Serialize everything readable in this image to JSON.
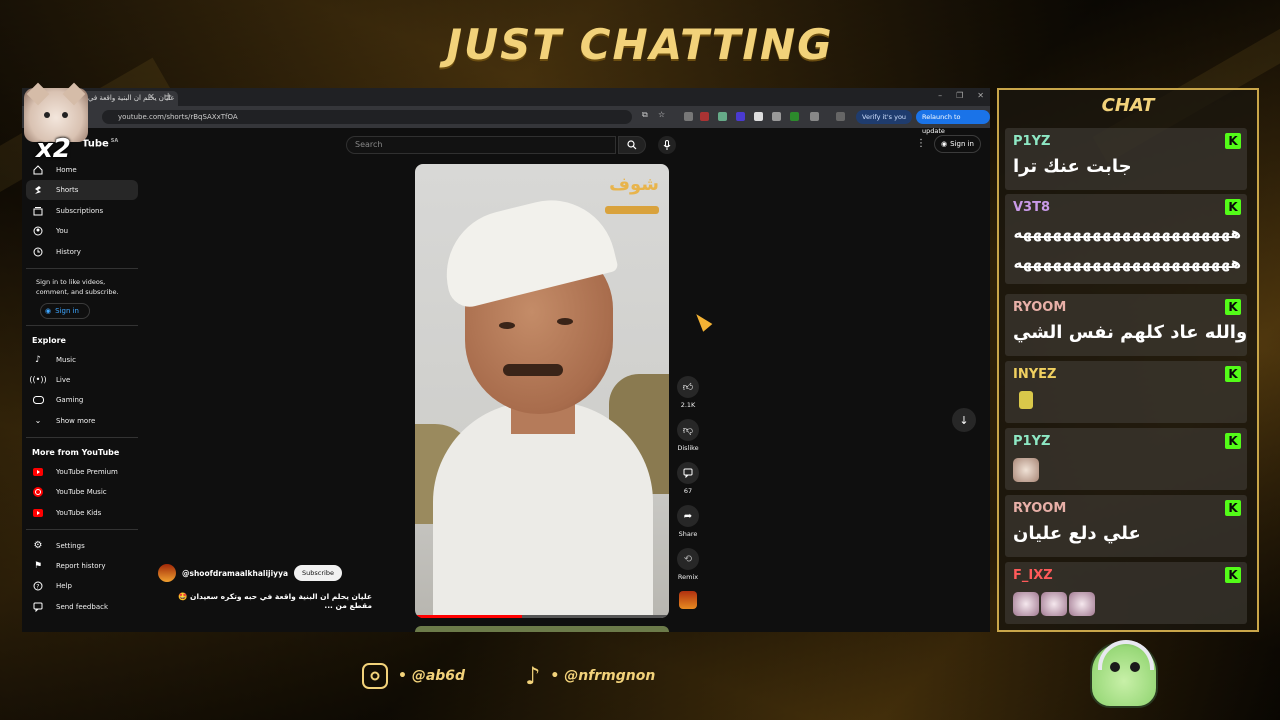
{
  "overlay": {
    "title": "JUST CHATTING",
    "cat_multiplier": "x2",
    "instagram": "@ab6d",
    "tiktok": "@nfrmgnon"
  },
  "browser": {
    "tab_title": "عليان يحلم ان البنية واقعة في",
    "url": "youtube.com/shorts/rBqSAXxTfOA",
    "verify_label": "Verify it's you",
    "relaunch_label": "Relaunch to update"
  },
  "youtube": {
    "logo_text": "Tube",
    "logo_region": "SA",
    "search_placeholder": "Search",
    "signin_top": "Sign in",
    "nav": [
      {
        "label": "Home",
        "icon": "home-icon"
      },
      {
        "label": "Shorts",
        "icon": "shorts-icon"
      },
      {
        "label": "Subscriptions",
        "icon": "subscriptions-icon"
      },
      {
        "label": "You",
        "icon": "user-icon"
      },
      {
        "label": "History",
        "icon": "history-icon"
      }
    ],
    "signin_note": "Sign in to like videos, comment, and subscribe.",
    "signin_side": "Sign in",
    "explore_heading": "Explore",
    "explore": [
      {
        "label": "Music",
        "icon": "music-icon"
      },
      {
        "label": "Live",
        "icon": "live-icon"
      },
      {
        "label": "Gaming",
        "icon": "gaming-icon"
      },
      {
        "label": "Show more",
        "icon": "chevron-down-icon"
      }
    ],
    "more_heading": "More from YouTube",
    "more": [
      {
        "label": "YouTube Premium"
      },
      {
        "label": "YouTube Music"
      },
      {
        "label": "YouTube Kids"
      }
    ],
    "footer_nav": [
      {
        "label": "Settings",
        "icon": "gear-icon"
      },
      {
        "label": "Report history",
        "icon": "flag-icon"
      },
      {
        "label": "Help",
        "icon": "help-icon"
      },
      {
        "label": "Send feedback",
        "icon": "feedback-icon"
      }
    ],
    "video": {
      "watermark": "شوف",
      "progress": 0.42,
      "likes": "2.1K",
      "dislike_label": "Dislike",
      "comments": "67",
      "share_label": "Share",
      "remix_label": "Remix",
      "channel": "@shoofdramaalkhalijiyya",
      "subscribe_label": "Subscribe",
      "title": "عليان يحلم ان البنية واقعة في حبه وتكره سعيدان 🤩 مقطع من ..."
    }
  },
  "chat": {
    "heading": "CHAT",
    "kick_glyph": "K",
    "messages": [
      {
        "user": "P1YZ",
        "color": "#8ee8c4",
        "text": "جابت عنك ترا"
      },
      {
        "user": "V3T8",
        "color": "#c99ae8",
        "text": "ههههههههههههههههههههههه",
        "text2": "ههههههههههههههههههههههه"
      },
      {
        "user": "RYOOM",
        "color": "#e8b0a8",
        "text": "والله عاد كلهم نفس الشي"
      },
      {
        "user": "INYEZ",
        "color": "#f0d060",
        "emote": "banana-emote"
      },
      {
        "user": "P1YZ",
        "color": "#8ee8c4",
        "emote": "cat-emote"
      },
      {
        "user": "RYOOM",
        "color": "#e8b0a8",
        "text": "علي دلع عليان"
      },
      {
        "user": "F_IXZ",
        "color": "#ff5a5a",
        "emote": "cat-emote-x3"
      }
    ]
  }
}
